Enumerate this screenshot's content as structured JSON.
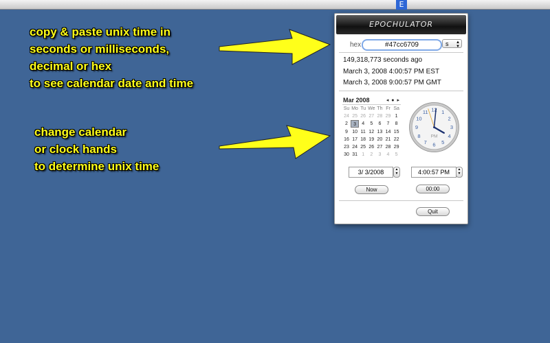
{
  "menubar": {
    "status_icon": "E"
  },
  "callouts": {
    "top": [
      "copy & paste unix time in",
      "seconds or milliseconds,",
      "decimal or hex",
      "to see calendar date and time"
    ],
    "bottom": [
      "change calendar",
      "or clock hands",
      "to determine unix time"
    ]
  },
  "panel": {
    "title": "EPOCHULATOR",
    "hex_label": "hex",
    "hex_value": "#47cc6709",
    "unit": "s",
    "seconds_ago": "149,318,773 seconds ago",
    "date_est": "March 3, 2008 4:00:57 PM EST",
    "date_gmt": "March 3, 2008 9:00:57 PM GMT",
    "calendar": {
      "month": "Mar 2008",
      "nav": [
        "◂",
        "●",
        "▸"
      ],
      "weekdays": [
        "Su",
        "Mo",
        "Tu",
        "We",
        "Th",
        "Fr",
        "Sa"
      ],
      "weeks": [
        [
          "24",
          "25",
          "26",
          "27",
          "28",
          "29",
          "1"
        ],
        [
          "2",
          "3",
          "4",
          "5",
          "6",
          "7",
          "8"
        ],
        [
          "9",
          "10",
          "11",
          "12",
          "13",
          "14",
          "15"
        ],
        [
          "16",
          "17",
          "18",
          "19",
          "20",
          "21",
          "22"
        ],
        [
          "23",
          "24",
          "25",
          "26",
          "27",
          "28",
          "29"
        ],
        [
          "30",
          "31",
          "1",
          "2",
          "3",
          "4",
          "5"
        ]
      ]
    },
    "clock": {
      "ampm": "PM",
      "hour": 4,
      "minute": 0,
      "second": 57
    },
    "date_field": "3/ 3/2008",
    "time_field": "4:00:57 PM",
    "now_button": "Now",
    "zero_button": "00:00",
    "quit_button": "Quit"
  },
  "colors": {
    "background": "#3f6596",
    "callout_text": "#ffff1a",
    "arrow": "#ffff1a",
    "selected_day": "#a9b3c2"
  }
}
